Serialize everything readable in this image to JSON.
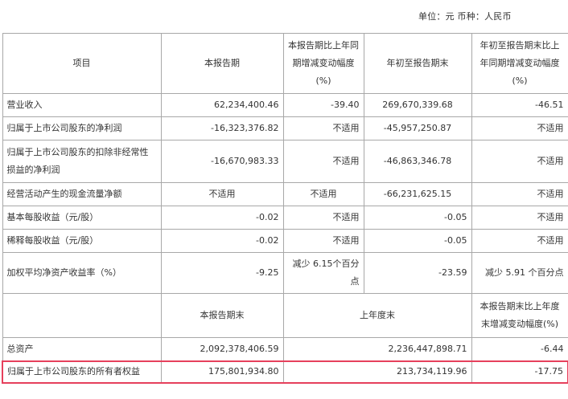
{
  "unit_line": "单位：元  币种：人民币",
  "header": {
    "item": "项目",
    "current_period": "本报告期",
    "yoy_change": "本报告期比上年同期增减变动幅度(%)",
    "ytd": "年初至报告期末",
    "ytd_change": "年初至报告期末比上年同期增减变动幅度(%)"
  },
  "rows": [
    {
      "item": "营业收入",
      "current": "62,234,400.46",
      "yoy": "-39.40",
      "ytd": "269,670,339.68",
      "ytd_change": "-46.51"
    },
    {
      "item": "归属于上市公司股东的净利润",
      "current": "-16,323,376.82",
      "yoy": "不适用",
      "ytd": "-45,957,250.87",
      "ytd_change": "不适用"
    },
    {
      "item": "归属于上市公司股东的扣除非经常性损益的净利润",
      "current": "-16,670,983.33",
      "yoy": "不适用",
      "ytd": "-46,863,346.78",
      "ytd_change": "不适用"
    },
    {
      "item": "经营活动产生的现金流量净额",
      "current": "不适用",
      "yoy": "不适用",
      "ytd": "-66,231,625.15",
      "ytd_change": "不适用"
    },
    {
      "item": "基本每股收益（元/股）",
      "current": "-0.02",
      "yoy": "不适用",
      "ytd": "-0.05",
      "ytd_change": "不适用"
    },
    {
      "item": "稀释每股收益（元/股）",
      "current": "-0.02",
      "yoy": "不适用",
      "ytd": "-0.05",
      "ytd_change": "不适用"
    },
    {
      "item": "加权平均净资产收益率（%）",
      "current": "-9.25",
      "yoy": "减少 6.15个百分点",
      "ytd": "-23.59",
      "ytd_change": "减少 5.91 个百分点"
    }
  ],
  "header2": {
    "period_end": "本报告期末",
    "prior_year_end": "上年度末",
    "change": "本报告期末比上年度末增减变动幅度(%)"
  },
  "rows2": [
    {
      "item": "总资产",
      "period_end": "2,092,378,406.59",
      "prior_year_end": "2,236,447,898.71",
      "change": "-6.44"
    },
    {
      "item": "归属于上市公司股东的所有者权益",
      "period_end": "175,801,934.80",
      "prior_year_end": "213,734,119.96",
      "change": "-17.75"
    }
  ]
}
